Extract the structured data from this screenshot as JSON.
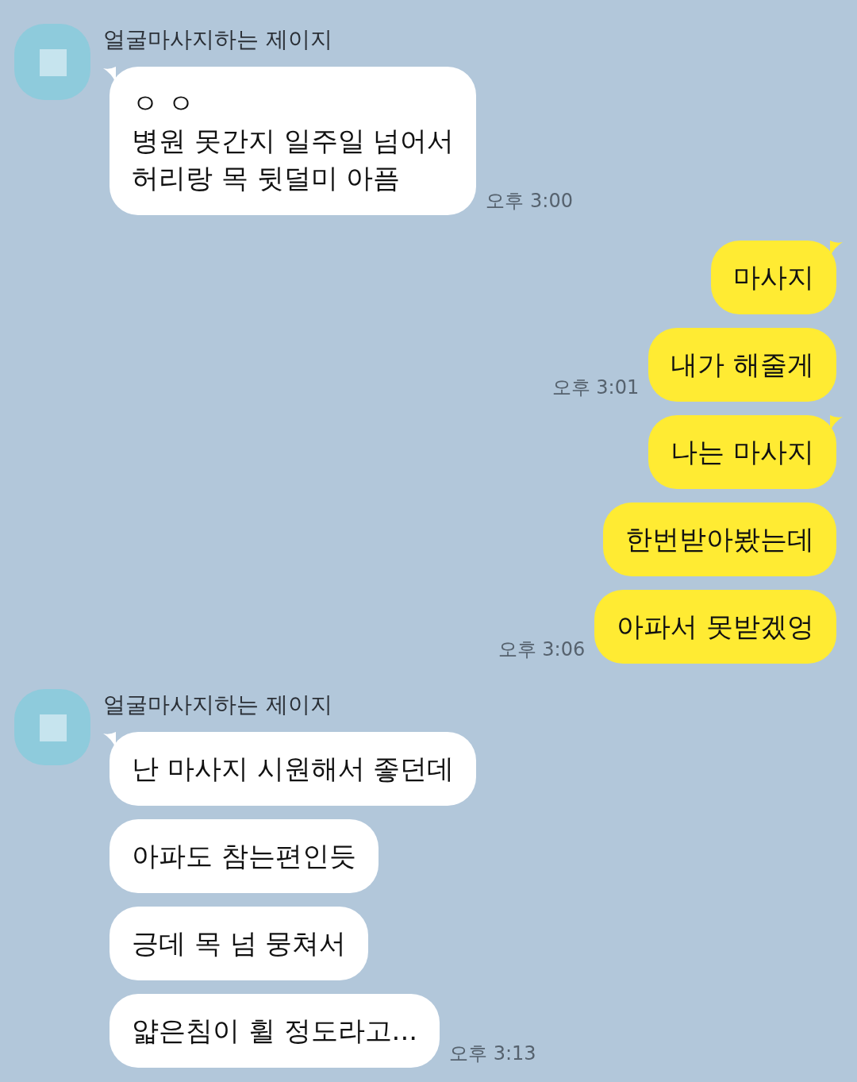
{
  "groups": [
    {
      "kind": "incoming",
      "sender": "얼굴마사지하는 제이지",
      "messages": [
        {
          "text": "ㅇ ㅇ\n병원 못간지 일주일 넘어서\n허리랑 목 뒷덜미 아픔",
          "tail": true,
          "time": "오후 3:00"
        }
      ]
    },
    {
      "kind": "outgoing",
      "messages": [
        {
          "text": "마사지",
          "tail": true
        },
        {
          "text": "내가 해줄게",
          "tail": false,
          "time": "오후 3:01"
        },
        {
          "text": "나는 마사지",
          "tail": true
        },
        {
          "text": "한번받아봤는데",
          "tail": false
        },
        {
          "text": "아파서 못받겠엉",
          "tail": false,
          "time": "오후 3:06"
        }
      ]
    },
    {
      "kind": "incoming",
      "sender": "얼굴마사지하는 제이지",
      "messages": [
        {
          "text": "난 마사지 시원해서 좋던데",
          "tail": true
        },
        {
          "text": "아파도 참는편인듯",
          "tail": false
        },
        {
          "text": "긍데 목 넘 뭉쳐서",
          "tail": false
        },
        {
          "text": "얇은침이 휠 정도라고...",
          "tail": false,
          "time": "오후 3:13"
        }
      ]
    }
  ]
}
